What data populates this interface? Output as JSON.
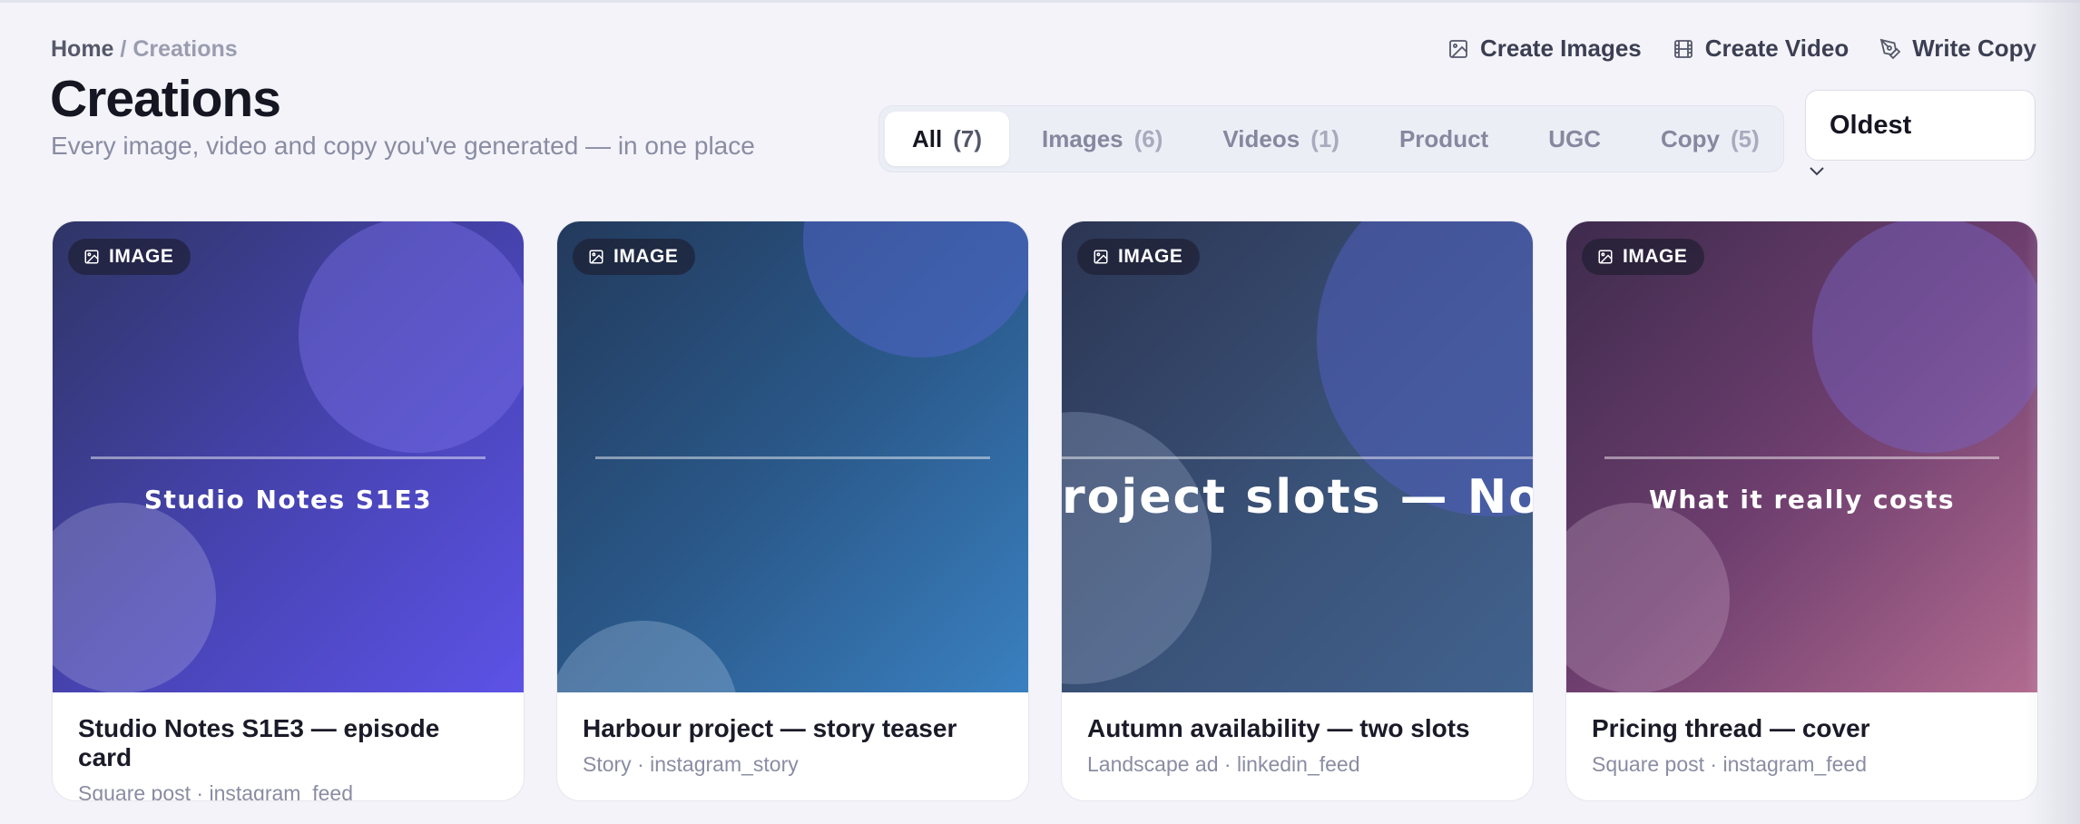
{
  "breadcrumb": {
    "home": "Home",
    "separator": "/",
    "current": "Creations"
  },
  "page": {
    "title": "Creations",
    "subtitle": "Every image, video and copy you've generated — in one place"
  },
  "actions": [
    {
      "label": "Create Images",
      "icon": "image-icon"
    },
    {
      "label": "Create Video",
      "icon": "film-icon"
    },
    {
      "label": "Write Copy",
      "icon": "pen-icon"
    }
  ],
  "tabs": [
    {
      "label": "All",
      "count": "(7)",
      "active": true
    },
    {
      "label": "Images",
      "count": "(6)",
      "active": false
    },
    {
      "label": "Videos",
      "count": "(1)",
      "active": false
    },
    {
      "label": "Product",
      "count": "",
      "active": false
    },
    {
      "label": "UGC",
      "count": "",
      "active": false
    },
    {
      "label": "Copy",
      "count": "(5)",
      "active": false
    }
  ],
  "sort": {
    "selected": "Oldest"
  },
  "cards": [
    {
      "badge": "IMAGE",
      "caption": "Studio Notes  S1E3",
      "title": "Studio Notes S1E3 — episode card",
      "meta": "Square post · instagram_feed",
      "colors": {
        "primary": "#4844b4",
        "accent": "#5d52e6"
      }
    },
    {
      "badge": "IMAGE",
      "caption": "",
      "title": "Harbour project — story teaser",
      "meta": "Story · instagram_story",
      "colors": {
        "primary": "#2a5889",
        "accent": "#3a80c0"
      }
    },
    {
      "badge": "IMAGE",
      "caption": "roject slots — Nove",
      "title": "Autumn availability — two slots",
      "meta": "Landscape ad · linkedin_feed",
      "colors": {
        "primary": "#3a5278",
        "accent": "#41628e"
      }
    },
    {
      "badge": "IMAGE",
      "caption": "What it really costs",
      "title": "Pricing thread — cover",
      "meta": "Square post · instagram_feed",
      "colors": {
        "primary": "#6d3e6e",
        "accent": "#b26b90"
      }
    }
  ]
}
